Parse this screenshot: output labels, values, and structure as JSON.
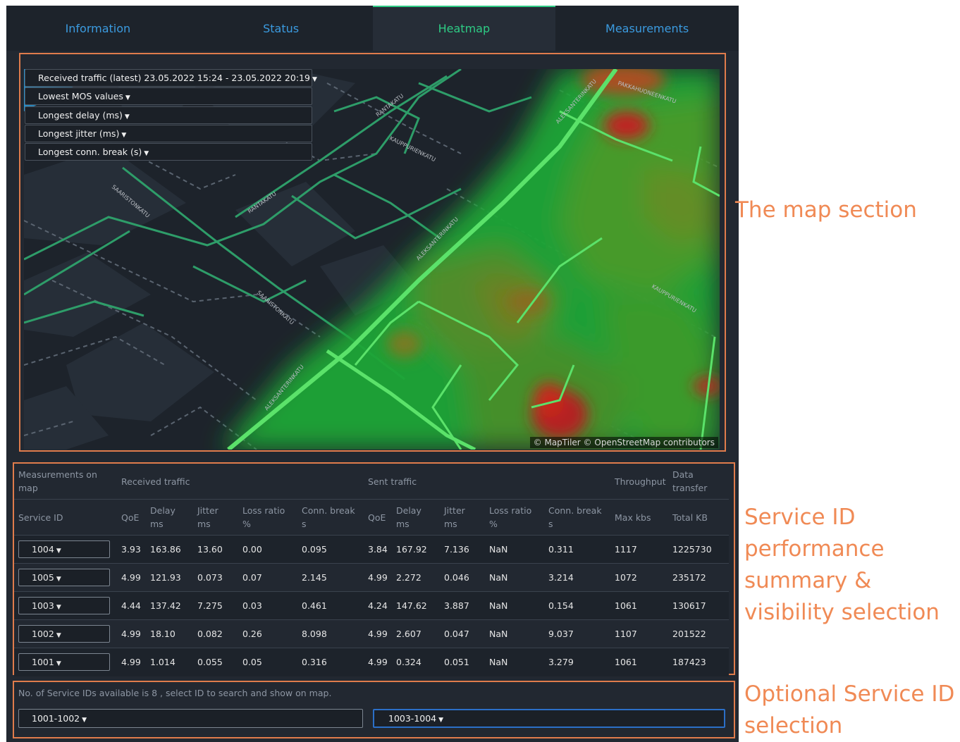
{
  "tabs": [
    "Information",
    "Status",
    "Heatmap",
    "Measurements"
  ],
  "active_tab": "Heatmap",
  "map": {
    "dropdowns": [
      "Received traffic (latest) 23.05.2022 15:24 - 23.05.2022 20:19",
      "Lowest MOS values",
      "Longest delay (ms)",
      "Longest jitter (ms)",
      "Longest conn. break (s)"
    ],
    "street_labels": [
      "RANTAKATU",
      "KAUPPURIENKATU",
      "SAARISTONKATU",
      "RANTAKATU",
      "ALEKSANTERINKATU",
      "PAKKAHUONEENKATU",
      "ALEKSANTERINKATU",
      "SAARISTONKATU",
      "KAUPPURIENKATU",
      "ALEKSANTERINKATU"
    ],
    "attribution": "© MapTiler © OpenStreetMap contributors"
  },
  "table": {
    "group_headers": {
      "measurements": "Measurements on map",
      "received": "Received traffic",
      "sent": "Sent traffic",
      "throughput": "Throughput",
      "data_transfer": "Data transfer"
    },
    "columns": {
      "service_id": "Service ID",
      "qoe": "QoE",
      "delay": "Delay",
      "jitter": "Jitter",
      "loss_ratio": "Loss ratio",
      "conn_break": "Conn. break",
      "max_kbs": "Max kbs",
      "total_kb": "Total KB",
      "unit_ms": "ms",
      "unit_pct": "%",
      "unit_s": "s"
    },
    "rows": [
      [
        "1004",
        "3.93",
        "163.86",
        "13.60",
        "0.00",
        "0.095",
        "3.84",
        "167.92",
        "7.136",
        "NaN",
        "0.311",
        "1117",
        "1225730"
      ],
      [
        "1005",
        "4.99",
        "121.93",
        "0.073",
        "0.07",
        "2.145",
        "4.99",
        "2.272",
        "0.046",
        "NaN",
        "3.214",
        "1072",
        "235172"
      ],
      [
        "1003",
        "4.44",
        "137.42",
        "7.275",
        "0.03",
        "0.461",
        "4.24",
        "147.62",
        "3.887",
        "NaN",
        "0.154",
        "1061",
        "130617"
      ],
      [
        "1002",
        "4.99",
        "18.10",
        "0.082",
        "0.26",
        "8.098",
        "4.99",
        "2.607",
        "0.047",
        "NaN",
        "9.037",
        "1107",
        "201522"
      ],
      [
        "1001",
        "4.99",
        "1.014",
        "0.055",
        "0.05",
        "0.316",
        "4.99",
        "0.324",
        "0.051",
        "NaN",
        "3.279",
        "1061",
        "187423"
      ]
    ]
  },
  "bottom": {
    "info": "No. of Service IDs available is 8 , select ID to search and show on map.",
    "left_select": "1001-1002",
    "right_select": "1003-1004"
  },
  "annotations": {
    "map": "The map section",
    "table": [
      "Service ID",
      "performance",
      "summary &",
      "visibility selection"
    ],
    "optional": [
      "Optional Service ID",
      "selection"
    ]
  },
  "colors": {
    "accent_green": "#2ecc85",
    "tab_blue": "#3b9be0",
    "annotation_orange": "#e07c4c",
    "selected_border": "#2b6fc7"
  }
}
